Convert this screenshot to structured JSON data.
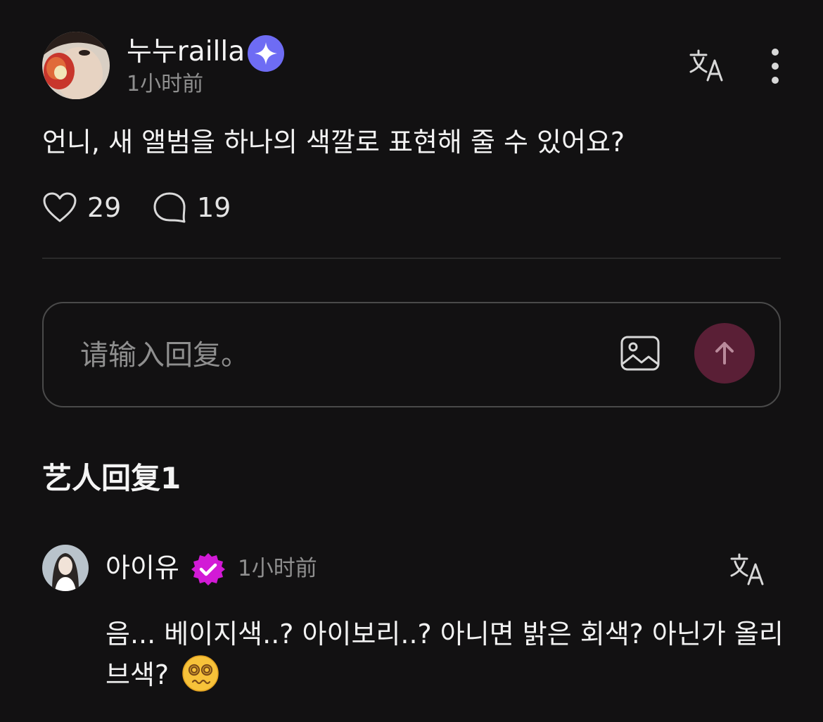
{
  "post": {
    "author": "누누railla",
    "time": "1小时前",
    "text": "언니, 새 앨범을 하나의 색깔로 표현해 줄 수 있어요?",
    "likes": "29",
    "comments": "19"
  },
  "reply_input": {
    "placeholder": "请输入回复。"
  },
  "artist_section": {
    "title": "艺人回复1"
  },
  "artist_reply": {
    "author": "아이유",
    "time": "1小时前",
    "text": "음... 베이지색..? 아이보리..? 아니면 밝은 회색? 아닌가 올리브색?"
  },
  "colors": {
    "background": "#121112",
    "sparkle_badge": "#6e6cf4",
    "verified_badge": "#d21ad6",
    "send_button": "#5a1f36"
  }
}
